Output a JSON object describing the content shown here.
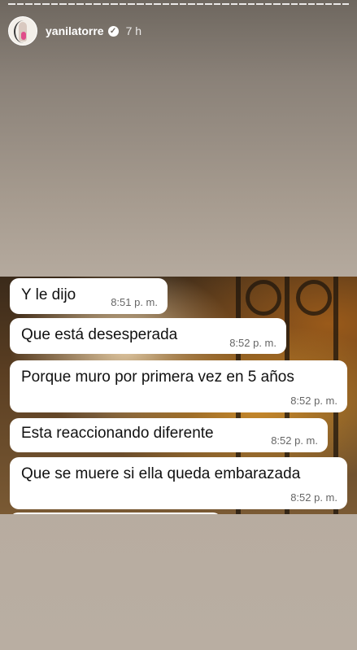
{
  "story": {
    "username": "yanilatorre",
    "time_ago": "7 h",
    "progress_segments": 40
  },
  "chat": {
    "messages": [
      {
        "text": "Y le dijo",
        "time": "8:51 p. m."
      },
      {
        "text": "Que está desesperada",
        "time": "8:52 p. m."
      },
      {
        "text": "Porque muro por primera vez en 5 años",
        "time": "8:52 p. m."
      },
      {
        "text": "Esta reaccionando diferente",
        "time": "8:52 p. m."
      },
      {
        "text": "Que se muere si ella queda embarazada",
        "time": "8:52 p. m."
      }
    ]
  },
  "colors": {
    "bubble": "#ffffff",
    "text": "#111111",
    "timestamp": "#666666"
  },
  "icons": {
    "verified": "verified-badge-icon"
  }
}
